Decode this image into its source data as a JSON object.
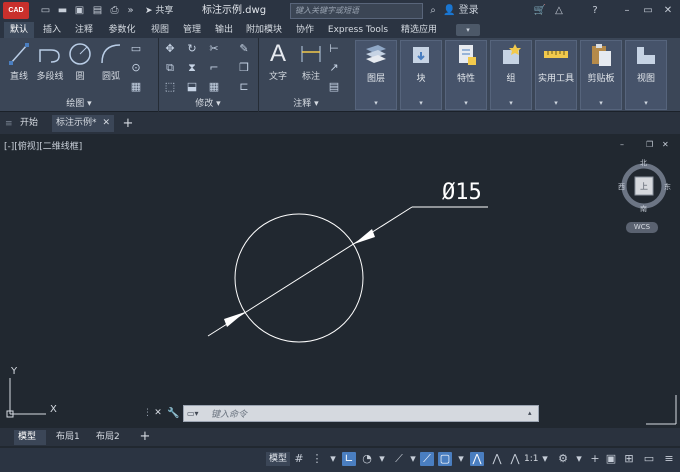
{
  "titlebar": {
    "logo_text": "CAD",
    "share_label": "共享",
    "document_title": "标注示例.dwg",
    "search_placeholder": "键入关键字或短语",
    "login_label": "登录"
  },
  "menu": {
    "tabs": [
      "默认",
      "插入",
      "注释",
      "参数化",
      "视图",
      "管理",
      "输出",
      "附加模块",
      "协作",
      "Express Tools",
      "精选应用"
    ],
    "active": "默认"
  },
  "ribbon": {
    "draw_tools": [
      "直线",
      "多段线",
      "圆",
      "圆弧"
    ],
    "draw_panel": "绘图",
    "modify_panel": "修改",
    "annotation_tools": [
      "文字",
      "标注"
    ],
    "annotation_panel": "注释",
    "big_panels": [
      "图层",
      "块",
      "特性",
      "组",
      "实用工具",
      "剪贴板",
      "视图"
    ]
  },
  "doc_tabs": {
    "start_label": "开始",
    "active_label": "标注示例*"
  },
  "viewport": {
    "view_label": "[-][俯视][二维线框]",
    "dimension_text": "Ø15",
    "viewcube": {
      "north": "北",
      "south": "南",
      "west": "西",
      "east": "东",
      "top_face": "上",
      "wcs": "WCS"
    },
    "ucs_y": "Y",
    "ucs_x": "X"
  },
  "command": {
    "placeholder": "键入命令"
  },
  "layout_tabs": {
    "tabs": [
      "模型",
      "布局1",
      "布局2"
    ],
    "active": "模型"
  },
  "statusbar": {
    "model_label": "模型",
    "scale_label": "1:1"
  },
  "colors": {
    "canvas": "#212830",
    "ribbon": "#3b4657",
    "accent": "#4a7ec0",
    "logo": "#c9302c"
  }
}
